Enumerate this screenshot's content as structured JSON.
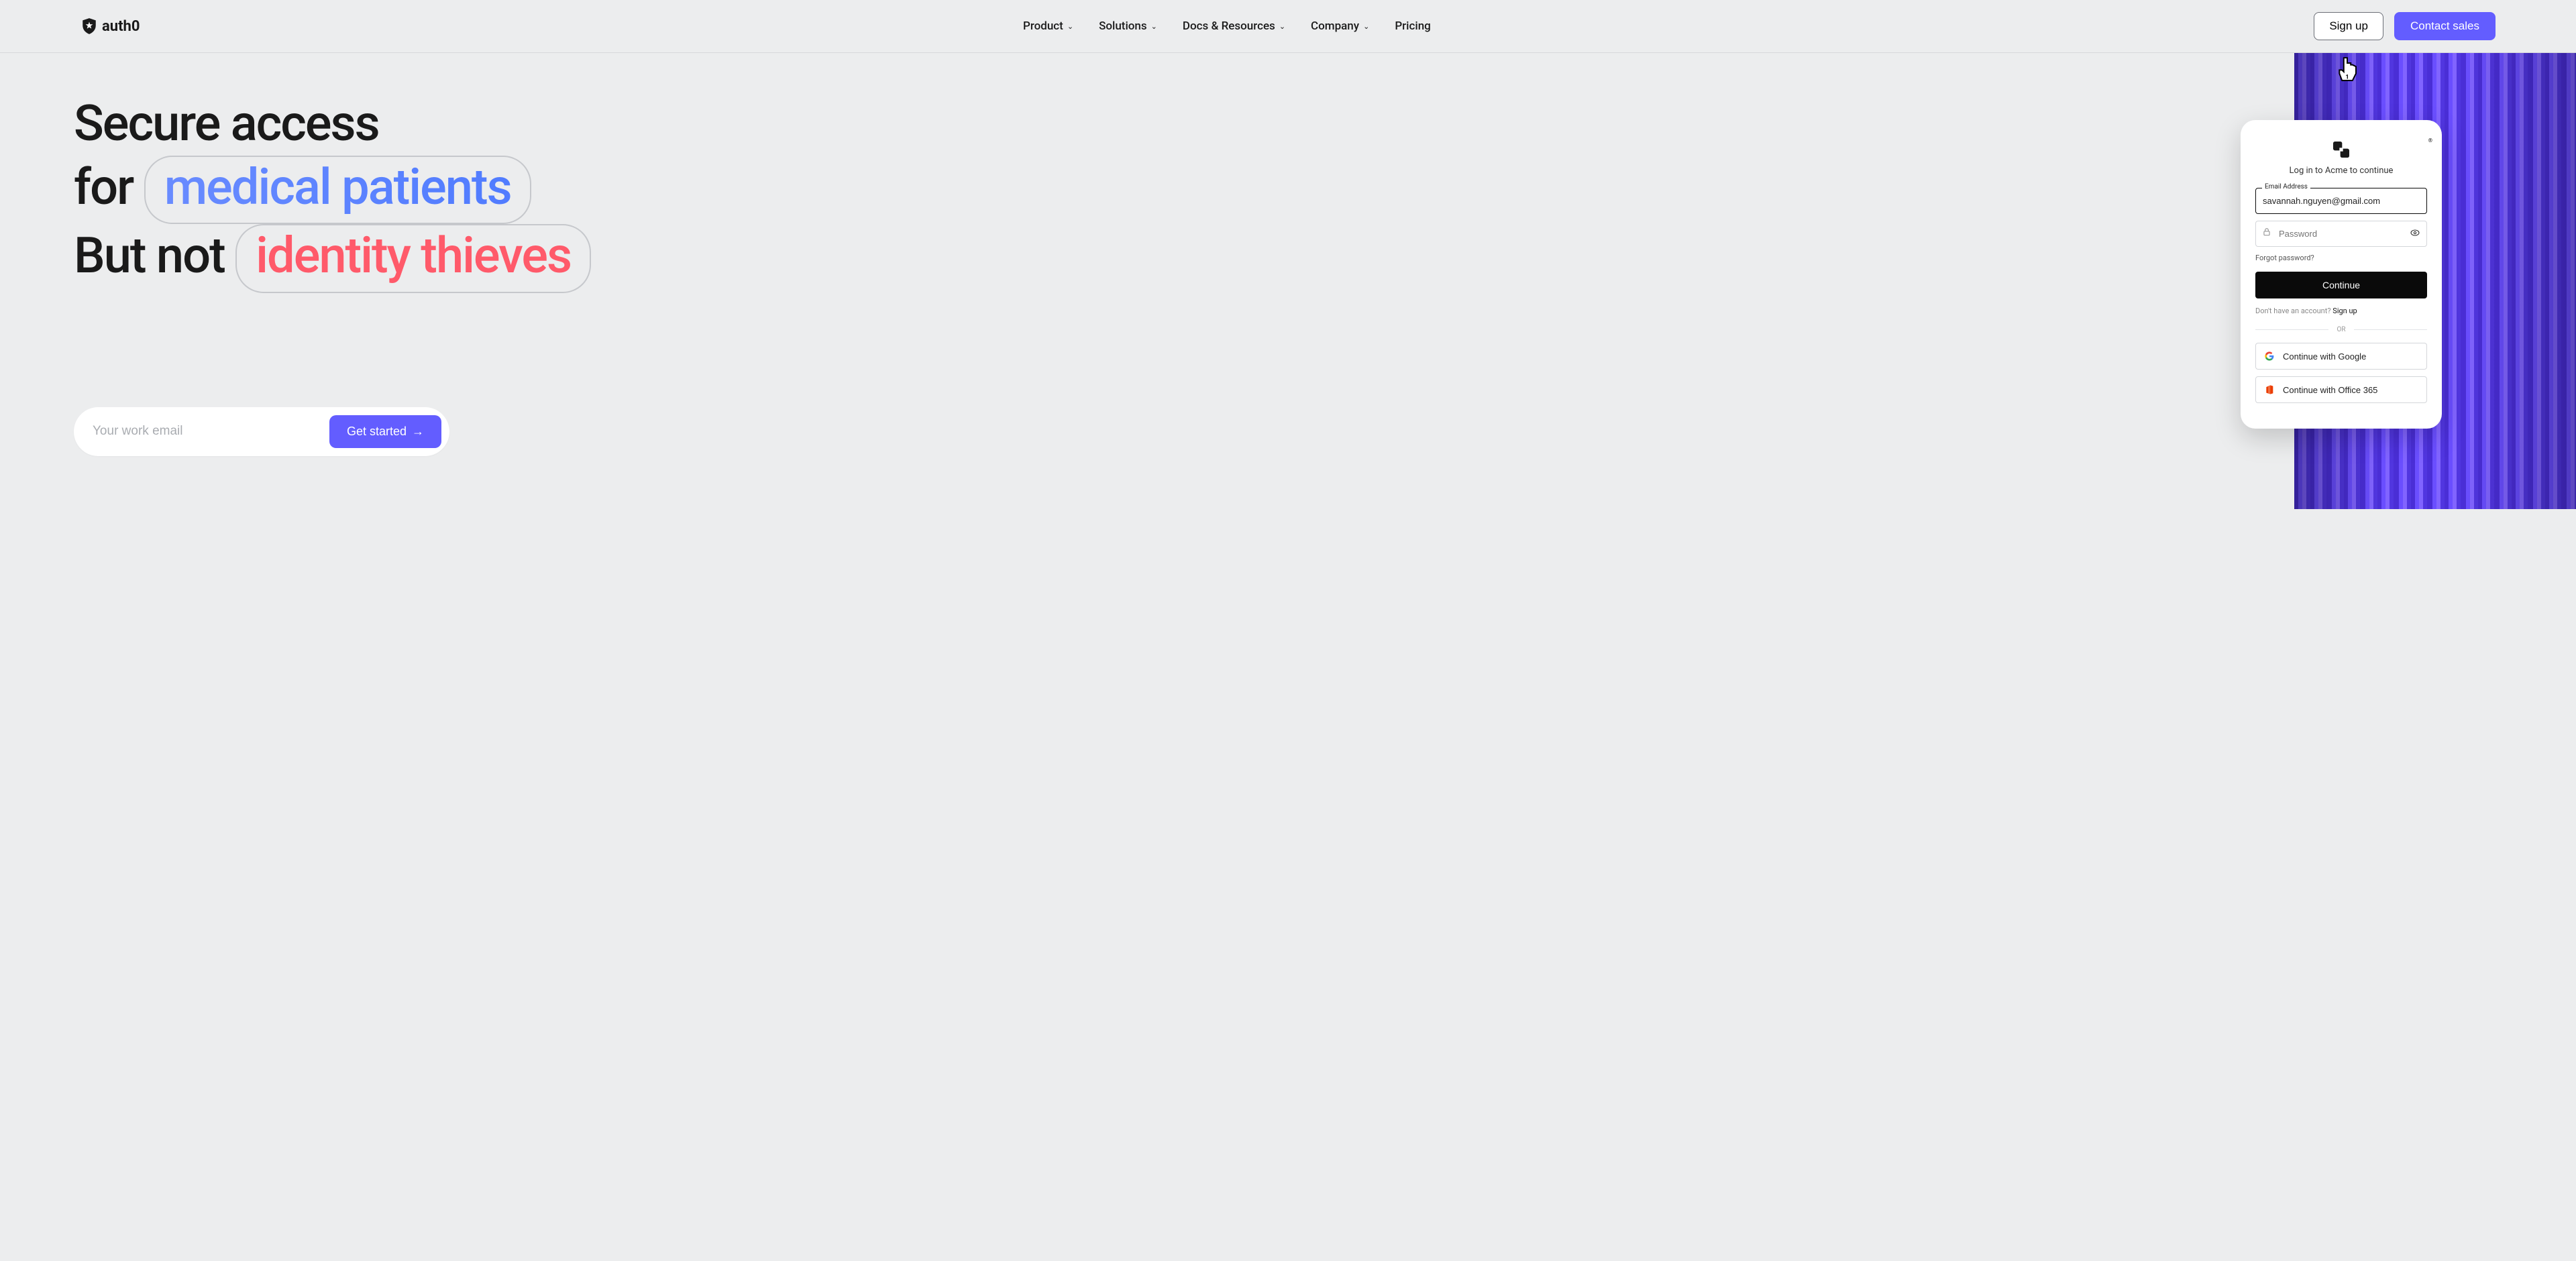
{
  "brand": {
    "name": "auth0"
  },
  "nav": {
    "items": [
      {
        "label": "Product"
      },
      {
        "label": "Solutions"
      },
      {
        "label": "Docs & Resources"
      },
      {
        "label": "Company"
      },
      {
        "label": "Pricing"
      }
    ],
    "signup": "Sign up",
    "contact": "Contact sales"
  },
  "hero": {
    "line1": "Secure access",
    "line2_prefix": "for",
    "line2_highlight": "medical patients",
    "line3_prefix": "But not",
    "line3_highlight": "identity thieves",
    "email_placeholder": "Your work email",
    "cta": "Get started"
  },
  "login": {
    "subtitle": "Log in to Acme to continue",
    "email_label": "Email Address",
    "email_value": "savannah.nguyen@gmail.com",
    "password_placeholder": "Password",
    "forgot": "Forgot password?",
    "continue": "Continue",
    "no_account": "Don't have an account?",
    "signup": "Sign up",
    "divider": "OR",
    "google": "Continue with Google",
    "office": "Continue with Office 365"
  }
}
